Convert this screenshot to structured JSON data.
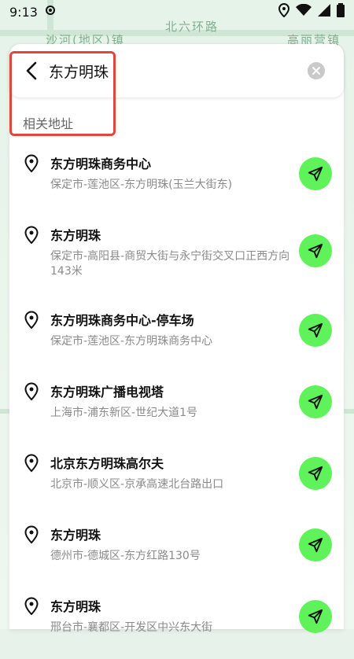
{
  "status_bar": {
    "time": "9:13"
  },
  "map_labels": [
    "沙河(地区)镇",
    "北六环路",
    "高丽营镇"
  ],
  "search": {
    "query": "东方明珠"
  },
  "section": {
    "label": "相关地址"
  },
  "results": [
    {
      "title": "东方明珠商务中心",
      "address": "保定市-莲池区-东方明珠(玉兰大街东)"
    },
    {
      "title": "东方明珠",
      "address": "保定市-高阳县-商贸大街与永宁街交叉口正西方向143米"
    },
    {
      "title": "东方明珠商务中心-停车场",
      "address": "保定市-莲池区-东方明珠商务中心"
    },
    {
      "title": "东方明珠广播电视塔",
      "address": "上海市-浦东新区-世纪大道1号"
    },
    {
      "title": "北京东方明珠高尔夫",
      "address": "北京市-顺义区-京承高速北台路出口"
    },
    {
      "title": "东方明珠",
      "address": "德州市-德城区-东方红路130号"
    },
    {
      "title": "东方明珠",
      "address": "邢台市-襄都区-开发区中兴东大街"
    }
  ],
  "colors": {
    "accent": "#5ff25a",
    "highlight": "#e0463b"
  }
}
